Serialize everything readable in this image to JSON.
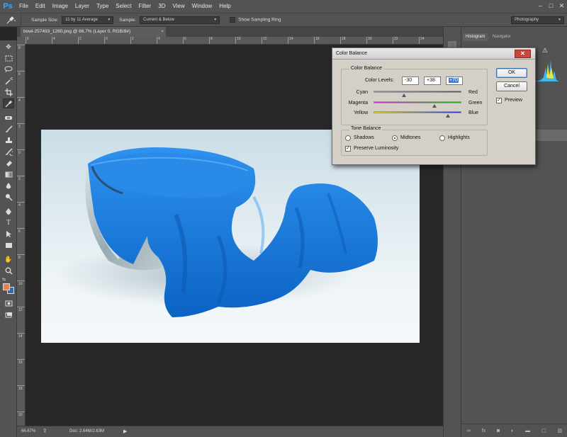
{
  "app": {
    "logo": "Ps"
  },
  "menu": [
    "File",
    "Edit",
    "Image",
    "Layer",
    "Type",
    "Select",
    "Filter",
    "3D",
    "View",
    "Window",
    "Help"
  ],
  "window_controls": [
    "–",
    "□",
    "✕"
  ],
  "options_bar": {
    "sample_size_label": "Sample Size:",
    "sample_size_value": "11 by 11 Average",
    "sample_label": "Sample:",
    "sample_value": "Current & Below",
    "show_ring_label": "Show Sampling Ring",
    "workspace": "Photography"
  },
  "document": {
    "tab_title": "bowl-257493_1280.png @ 66.7% (Layer 0, RGB/8#)",
    "tab_close": "×"
  },
  "status": {
    "zoom": "66.67%",
    "doc": "Doc: 2.64M/2.63M"
  },
  "panels": {
    "histogram_tab": "Histogram",
    "navigator_tab": "Navigator"
  },
  "dialog": {
    "title": "Color Balance",
    "close": "✕",
    "group_color_balance": "Color Balance",
    "color_levels_label": "Color Levels:",
    "levels": [
      "-30",
      "+38",
      "+70"
    ],
    "sliders": [
      {
        "left": "Cyan",
        "right": "Red",
        "value": -30
      },
      {
        "left": "Magenta",
        "right": "Green",
        "value": 38
      },
      {
        "left": "Yellow",
        "right": "Blue",
        "value": 70
      }
    ],
    "group_tone_balance": "Tone Balance",
    "tones": [
      "Shadows",
      "Midtones",
      "Highlights"
    ],
    "selected_tone": "Midtones",
    "preserve_luminosity": "Preserve Luminosity",
    "preserve_checked": true,
    "ok": "OK",
    "cancel": "Cancel",
    "preview": "Preview",
    "preview_checked": true,
    "check_mark": "✓"
  },
  "colors": {
    "foreground": "#e8834a",
    "background": "#3a6aa8",
    "cloth": "#1a7fe0"
  },
  "rulers": {
    "h": [
      "6",
      "4",
      "2",
      "0",
      "2",
      "4",
      "6",
      "8",
      "10",
      "12",
      "14",
      "16",
      "18",
      "20",
      "22",
      "24"
    ],
    "v": [
      "8",
      "6",
      "4",
      "2",
      "0",
      "2",
      "4",
      "6",
      "8",
      "10",
      "12",
      "14",
      "16",
      "18",
      "20"
    ]
  }
}
